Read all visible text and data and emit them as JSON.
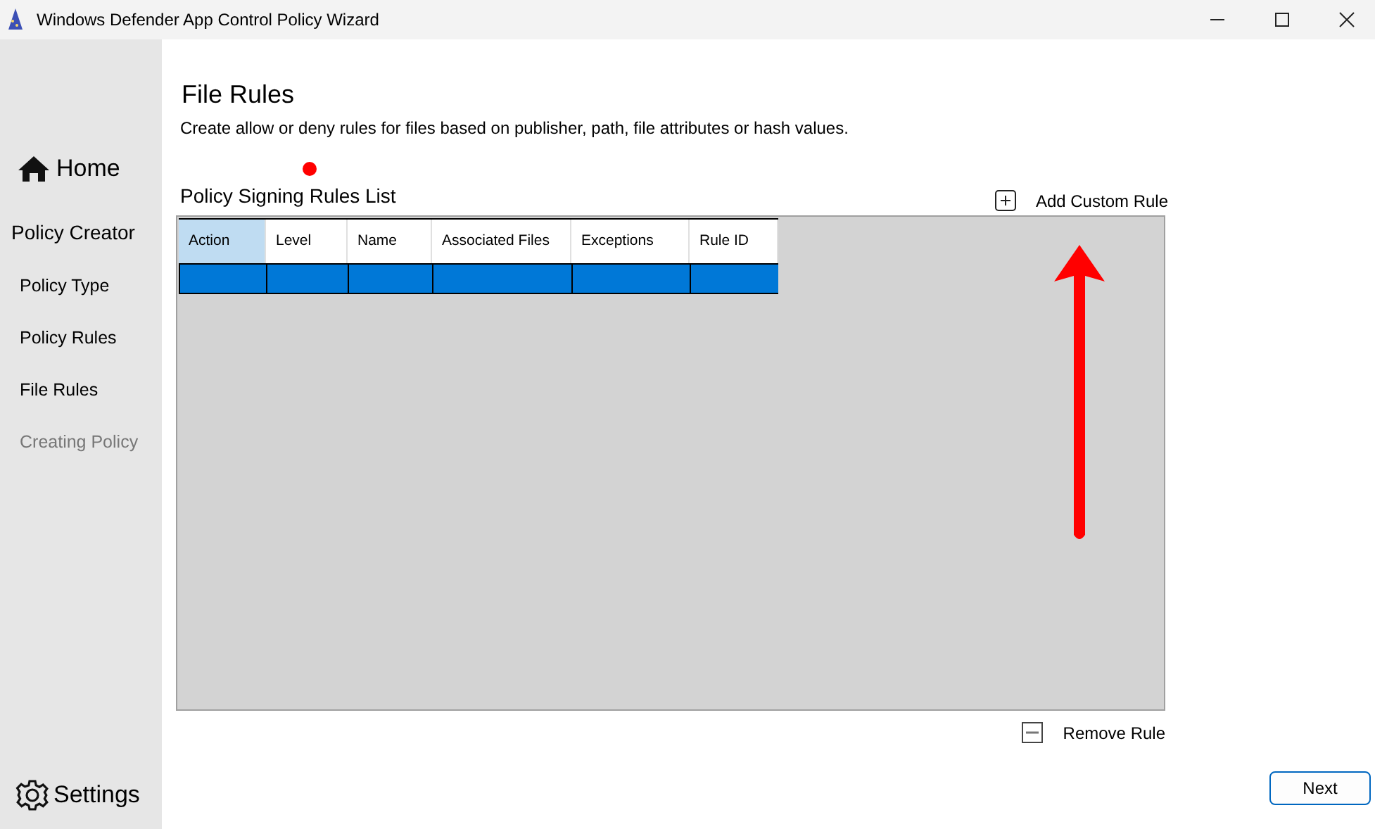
{
  "window": {
    "title": "Windows Defender App Control Policy Wizard"
  },
  "sidebar": {
    "home": "Home",
    "items": [
      {
        "label": "Policy Creator",
        "kind": "header",
        "disabled": false
      },
      {
        "label": "Policy Type",
        "kind": "item",
        "disabled": false
      },
      {
        "label": "Policy Rules",
        "kind": "item",
        "disabled": false
      },
      {
        "label": "File Rules",
        "kind": "item",
        "disabled": false
      },
      {
        "label": "Creating Policy",
        "kind": "item",
        "disabled": true
      }
    ],
    "settings": "Settings"
  },
  "page": {
    "title": "File Rules",
    "description": "Create allow or deny rules for files based on publisher, path, file attributes or hash values."
  },
  "table": {
    "title": "Policy Signing Rules List",
    "add_button": "Add Custom Rule",
    "remove_button": "Remove Rule",
    "columns": [
      {
        "label": "Action",
        "selected": true
      },
      {
        "label": "Level",
        "selected": false
      },
      {
        "label": "Name",
        "selected": false
      },
      {
        "label": "Associated Files",
        "selected": false
      },
      {
        "label": "Exceptions",
        "selected": false
      },
      {
        "label": "Rule ID",
        "selected": false
      }
    ],
    "rows": [
      {
        "selected": true
      }
    ]
  },
  "buttons": [
    "Next"
  ]
}
